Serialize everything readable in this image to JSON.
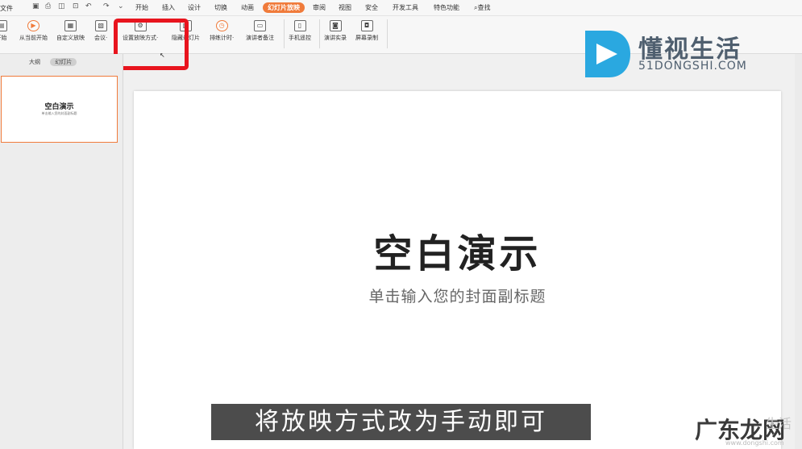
{
  "menubar": {
    "file_label": "文件",
    "quick_access": [
      "save-icon",
      "print-icon",
      "preview-icon",
      "undo-icon",
      "redo-icon",
      "more-icon"
    ],
    "tabs": [
      "开始",
      "插入",
      "设计",
      "切换",
      "动画",
      "幻灯片放映",
      "审阅",
      "视图",
      "安全",
      "开发工具",
      "特色功能"
    ],
    "search_label": "查找",
    "active_tab": "幻灯片放映"
  },
  "ribbon": {
    "buttons": [
      {
        "label": "开始",
        "icon": "play-from-start-icon"
      },
      {
        "label": "从当前开始",
        "icon": "play-current-icon"
      },
      {
        "label": "自定义放映",
        "icon": "custom-show-icon"
      },
      {
        "label": "会议·",
        "icon": "meeting-icon"
      },
      {
        "label": "设置放映方式·",
        "icon": "slideshow-settings-icon"
      },
      {
        "label": "隐藏幻灯片",
        "icon": "hide-slide-icon"
      },
      {
        "label": "排练计时·",
        "icon": "rehearse-timing-icon"
      },
      {
        "label": "演讲者备注",
        "icon": "speaker-notes-icon"
      },
      {
        "label": "手机遥控",
        "icon": "phone-remote-icon"
      },
      {
        "label": "演讲实录",
        "icon": "record-presentation-icon"
      },
      {
        "label": "屏幕录制",
        "icon": "screen-record-icon"
      }
    ]
  },
  "logo": {
    "name": "懂视生活",
    "url": "51DONGSHI.COM",
    "color": "#2aa8e0"
  },
  "sidebar": {
    "outline_tab": "大纲",
    "slides_tab": "幻灯片",
    "thumb_title": "空白演示",
    "thumb_subtitle": "单击输入您的封面副标题"
  },
  "slide": {
    "title": "空白演示",
    "subtitle": "单击输入您的封面副标题"
  },
  "caption": "将放映方式改为手动即可",
  "watermark": {
    "text": "广东龙网",
    "faint": "生活",
    "url": "www.dongshi.com"
  },
  "colors": {
    "accent": "#f07b3b",
    "highlight": "#e8141e",
    "logo_blue": "#2aa8e0"
  }
}
